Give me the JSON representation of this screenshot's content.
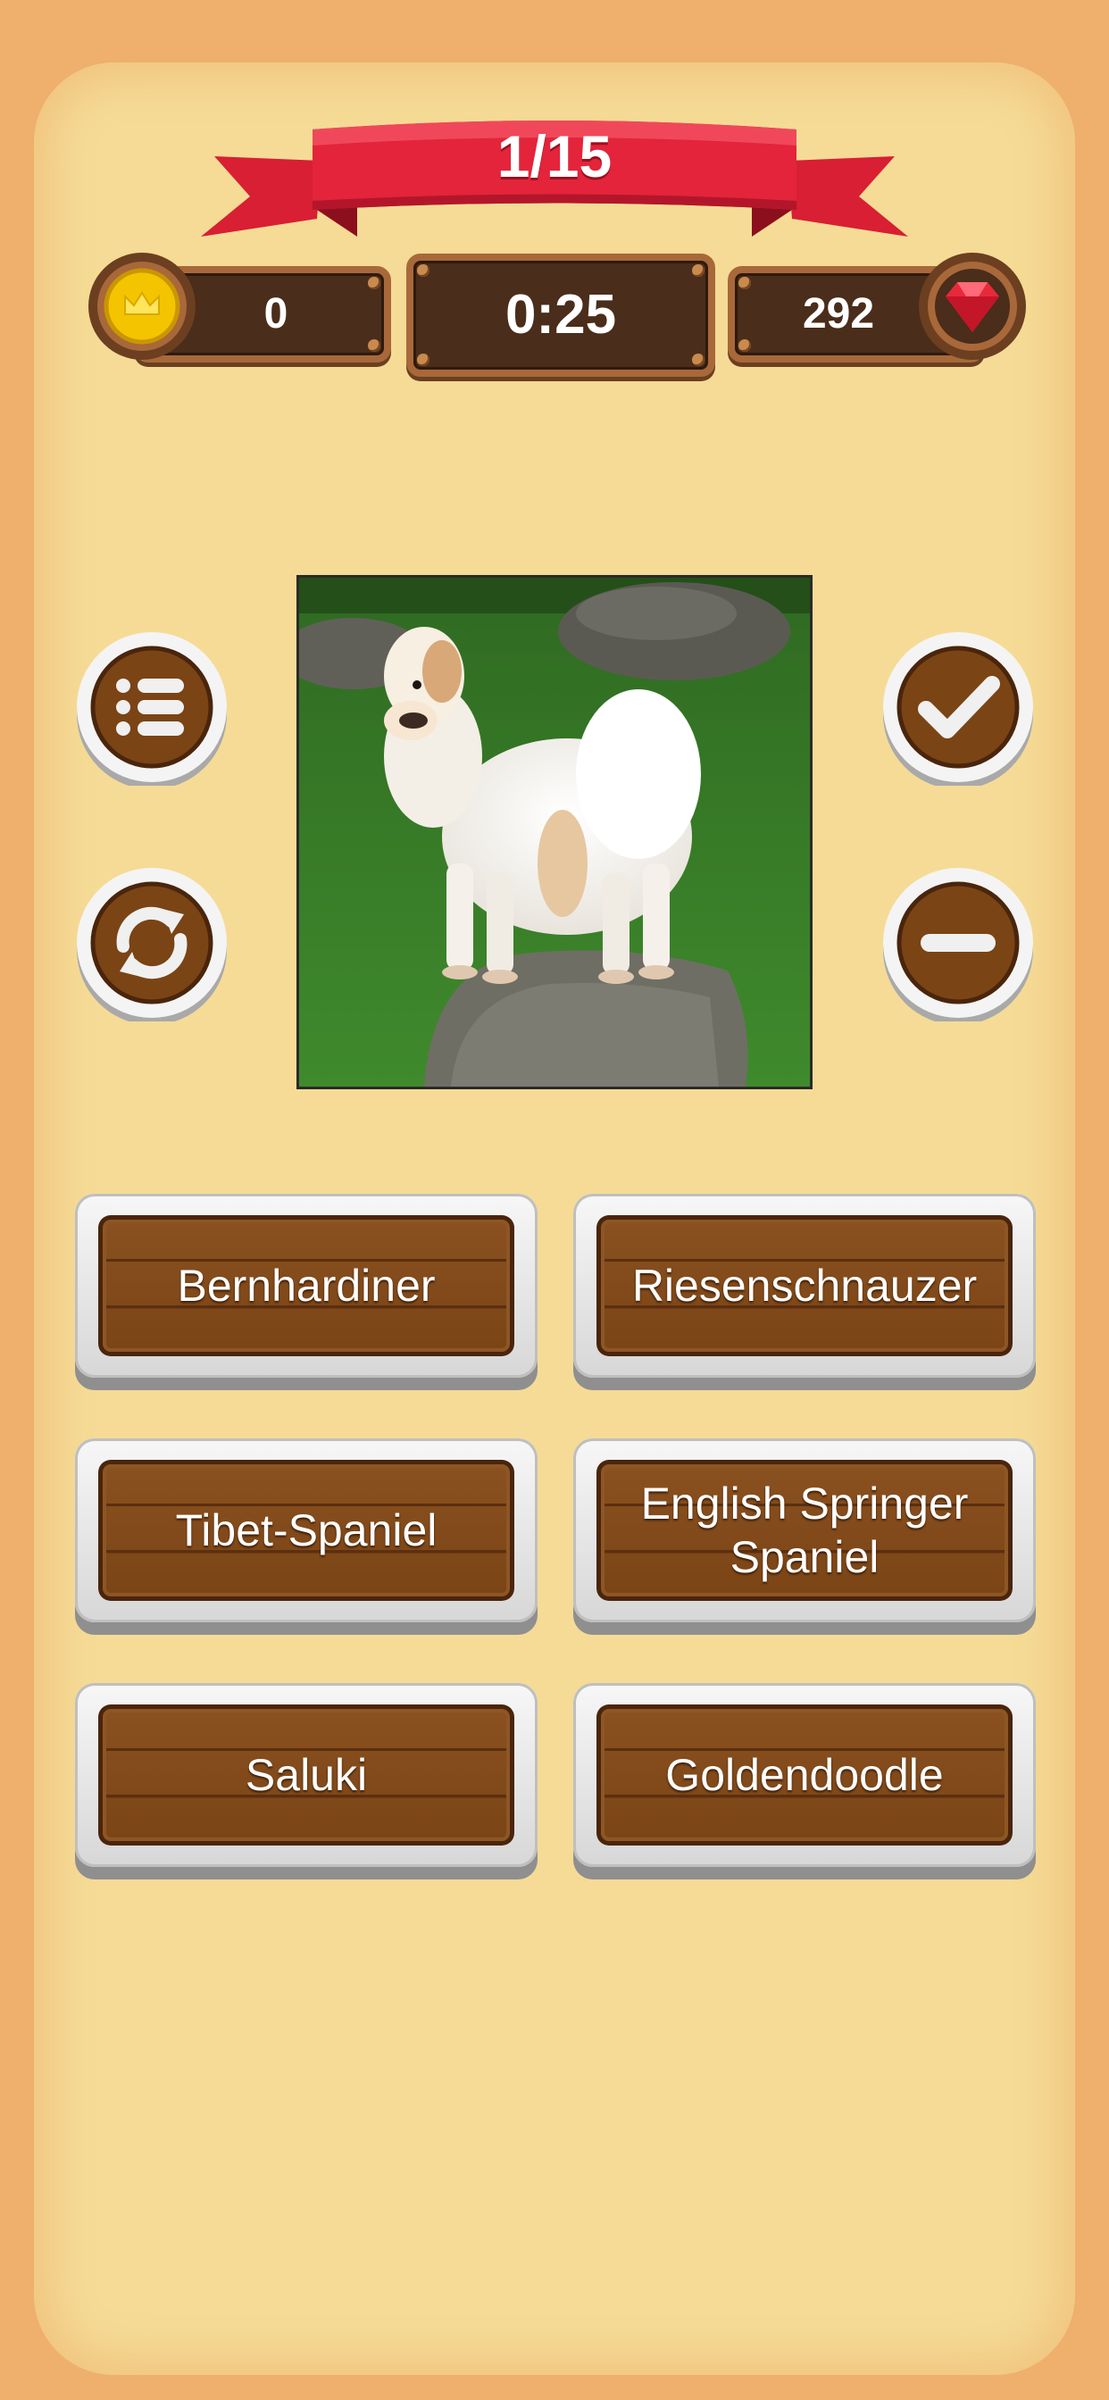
{
  "header": {
    "progress": "1/15"
  },
  "hud": {
    "coins": "0",
    "timer": "0:25",
    "gems": "292"
  },
  "question_image": {
    "subject": "dog"
  },
  "controls": {
    "left": [
      "list-icon",
      "refresh-icon"
    ],
    "right": [
      "check-icon",
      "minus-icon"
    ]
  },
  "answers": [
    {
      "label": "Bernhardiner"
    },
    {
      "label": "Riesenschnauzer"
    },
    {
      "label": "Tibet-Spaniel"
    },
    {
      "label": "English Springer Spaniel"
    },
    {
      "label": "Saluki"
    },
    {
      "label": "Goldendoodle"
    }
  ],
  "colors": {
    "background": "#eeb06c",
    "board": "#f5db96",
    "ribbon": "#e3243a",
    "wood": "#7a4415",
    "hud": "#4a2d1a",
    "coin": "#f5c400",
    "gem": "#e8293c"
  }
}
